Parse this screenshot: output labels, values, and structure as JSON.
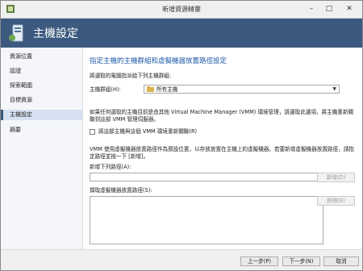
{
  "window": {
    "title": "新增資源精靈"
  },
  "header": {
    "title": "主機設定"
  },
  "sidebar": {
    "items": [
      {
        "label": "資源位置"
      },
      {
        "label": "認證"
      },
      {
        "label": "探索範圍"
      },
      {
        "label": "目標資源"
      },
      {
        "label": "主機設定"
      },
      {
        "label": "摘要"
      }
    ]
  },
  "main": {
    "section_title": "指定主機的主機群組和虛擬機器放置路徑設定",
    "group_instruction": "將選取的電腦指派給下列主機群組:",
    "host_group_label": "主機群組(H):",
    "host_group_value": "所有主機",
    "vmm_notice": "如果任何選取的主機目前是由其他 Virtual Machine Manager (VMM) 環境管理，請選取此選項，將主機重新關聯到這部 VMM 管理伺服器。",
    "reassociate_label": "將這部主機與這個 VMM 環境重新關聯(R)",
    "placement_notice": "VMM 使用虛擬機器放置路徑作為預設位置，以存放放置在主機上的虛擬機器。若要新增虛擬機器放置路徑，請指定路徑並按一下 [新增]。",
    "add_path_label": "新增下列路徑(A):",
    "add_button": "新增(D)",
    "placement_list_label": "擷取虛擬機器放置路徑(S):",
    "remove_button": "移除(E)"
  },
  "footer": {
    "back_button": "上一步(P)",
    "next_button": "下一步(N)",
    "cancel_button": "取消"
  }
}
